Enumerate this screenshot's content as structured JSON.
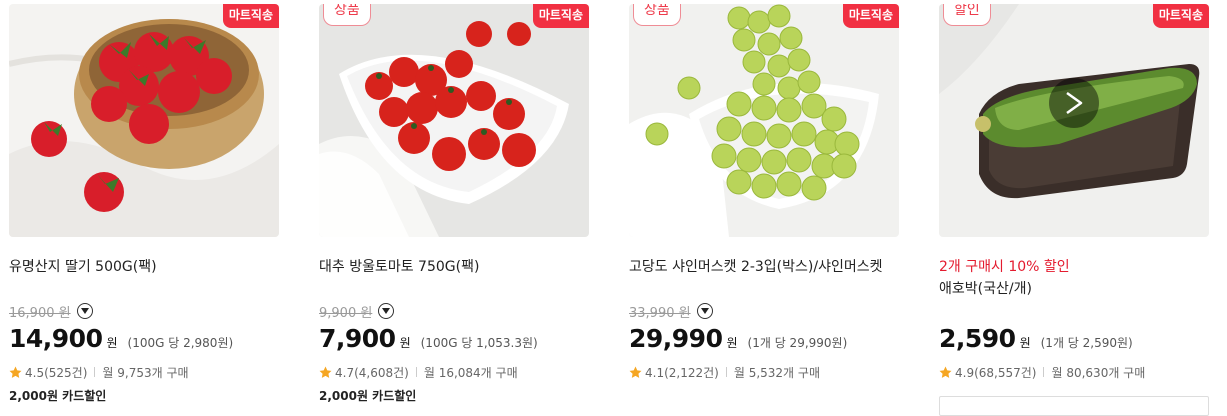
{
  "products": [
    {
      "name": "유명산지 딸기 500G(팩)",
      "corner_badge": "마트직송",
      "tag_badge": "",
      "original_price": "16,900 원",
      "price": "14,900",
      "currency": "원",
      "unit_price": "(100G 당 2,980원)",
      "rating_text": "4.5(525건)",
      "monthly_sales": "월 9,753개 구매",
      "card_discount": "2,000원 카드할인",
      "image": "strawberry-basket"
    },
    {
      "name": "대추 방울토마토 750G(팩)",
      "corner_badge": "마트직송",
      "tag_badge": "상품",
      "original_price": "9,900 원",
      "price": "7,900",
      "currency": "원",
      "unit_price": "(100G 당 1,053.3원)",
      "rating_text": "4.7(4,608건)",
      "monthly_sales": "월 16,084개 구매",
      "card_discount": "2,000원 카드할인",
      "image": "cherry-tomatoes"
    },
    {
      "name": "고당도 샤인머스캣 2-3입(박스)/샤인머스켓",
      "corner_badge": "마트직송",
      "tag_badge": "상품",
      "original_price": "33,990 원",
      "price": "29,990",
      "currency": "원",
      "unit_price": "(1개 당 29,990원)",
      "rating_text": "4.1(2,122건)",
      "monthly_sales": "월 5,532개 구매",
      "image": "shine-muscat"
    },
    {
      "promo": "2개 구매시 10% 할인",
      "name": "애호박(국산/개)",
      "corner_badge": "마트직송",
      "tag_badge": "할인",
      "price": "2,590",
      "currency": "원",
      "unit_price": "(1개 당 2,590원)",
      "rating_text": "4.9(68,557건)",
      "monthly_sales": "월 80,630개 구매",
      "image": "zucchini",
      "has_play_icon": true
    }
  ],
  "colors": {
    "badge_red": "#f13042",
    "promo_red": "#e41b2f",
    "star_yellow": "#f5a623"
  }
}
